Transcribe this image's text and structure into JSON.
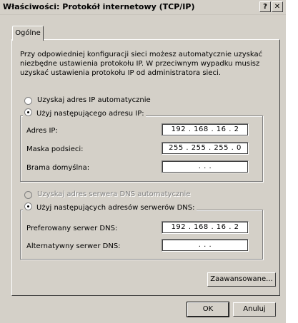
{
  "window": {
    "title": "Właściwości: Protokół internetowy (TCP/IP)",
    "help_button": "?",
    "close_button": "✕"
  },
  "tabs": [
    {
      "label": "Ogólne",
      "active": true
    }
  ],
  "description": "Przy odpowiedniej konfiguracji sieci możesz automatycznie uzyskać niezbędne ustawienia protokołu IP. W przeciwnym wypadku musisz uzyskać ustawienia protokołu IP od administratora sieci.",
  "ip_section": {
    "auto_option": "Uzyskaj adres IP automatycznie",
    "manual_option": "Użyj następującego adresu IP:",
    "selected": "manual",
    "fields": [
      {
        "label": "Adres IP:",
        "value": "192 . 168 . 16 . 2"
      },
      {
        "label": "Maska podsieci:",
        "value": "255 . 255 . 255 . 0"
      },
      {
        "label": "Brama domyślna:",
        "value": " .     .     . "
      }
    ]
  },
  "dns_section": {
    "auto_option": "Uzyskaj adres serwera DNS automatycznie",
    "auto_option_disabled": true,
    "manual_option": "Użyj następujących adresów serwerów DNS:",
    "selected": "manual",
    "fields": [
      {
        "label": "Preferowany serwer DNS:",
        "value": "192 . 168 . 16 . 2"
      },
      {
        "label": "Alternatywny serwer DNS:",
        "value": " .     .     . "
      }
    ]
  },
  "buttons": {
    "advanced": "Zaawansowane...",
    "ok": "OK",
    "cancel": "Anuluj"
  }
}
